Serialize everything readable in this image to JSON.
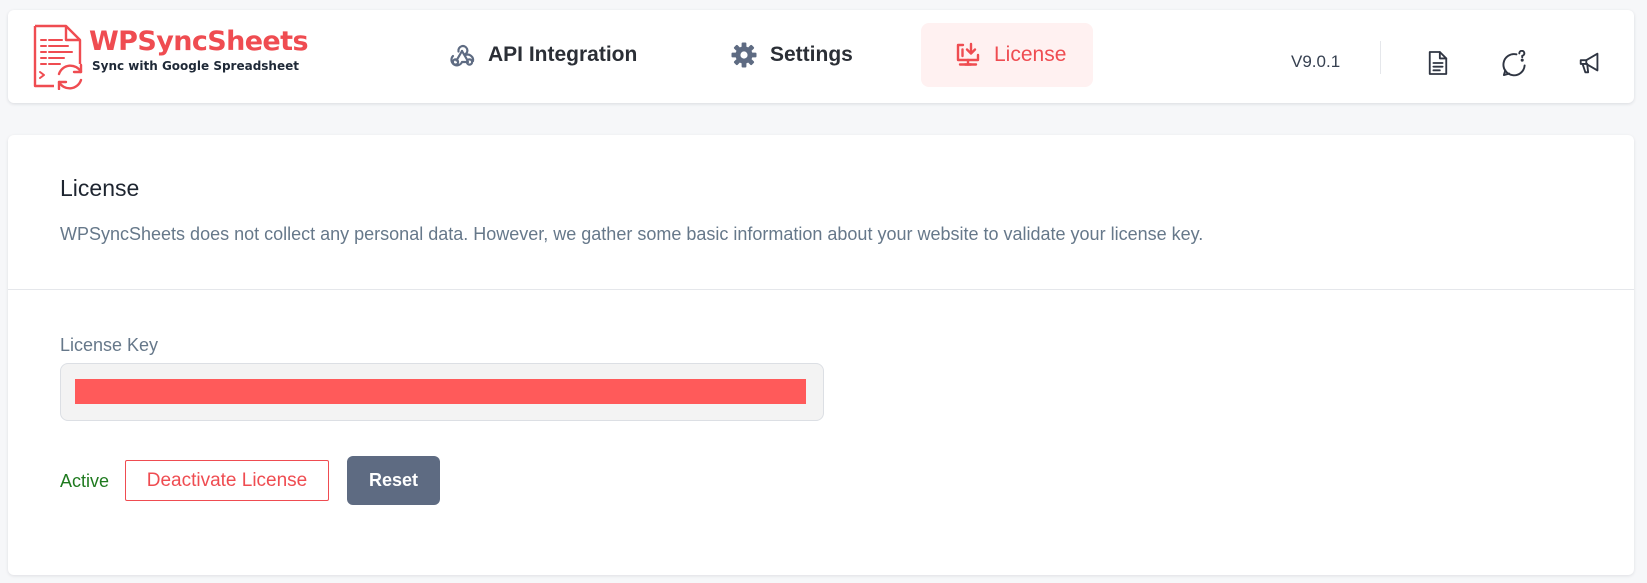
{
  "brand": {
    "name": "WPSyncSheets",
    "tagline": "Sync with Google Spreadsheet",
    "color": "#ef4c51"
  },
  "nav": {
    "items": [
      {
        "label": "API Integration",
        "icon": "webhook-icon",
        "active": false
      },
      {
        "label": "Settings",
        "icon": "gear-icon",
        "active": false
      },
      {
        "label": "License",
        "icon": "monitor-download-icon",
        "active": true
      }
    ]
  },
  "header": {
    "version": "V9.0.1",
    "tools": [
      "document-icon",
      "chat-question-icon",
      "megaphone-icon"
    ]
  },
  "license_panel": {
    "title": "License",
    "description": "WPSyncSheets does not collect any personal data. However, we gather some basic information about your website to validate your license key.",
    "field_label": "License Key",
    "field_value_redacted": true,
    "status": "Active",
    "status_color": "#1f7a1f",
    "deactivate_label": "Deactivate License",
    "reset_label": "Reset"
  }
}
